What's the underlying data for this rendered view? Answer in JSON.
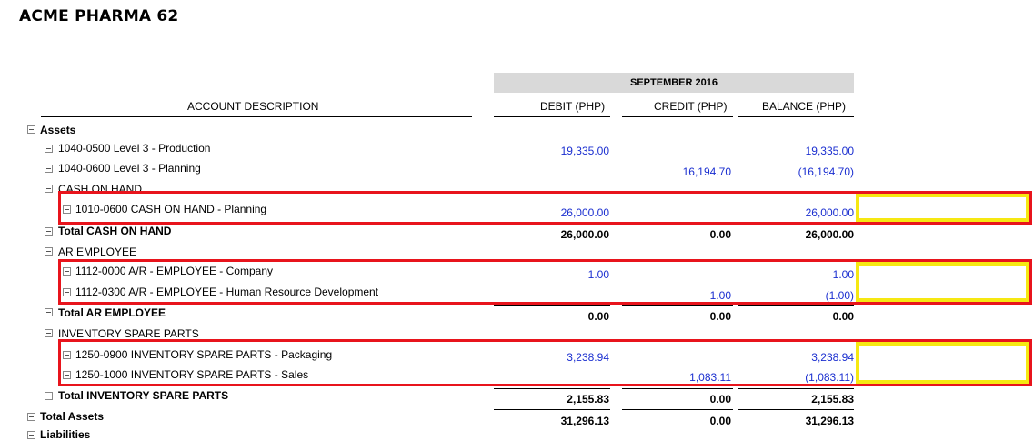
{
  "report": {
    "title": "ACME PHARMA 62",
    "period": "SEPTEMBER 2016",
    "columns": {
      "description": "ACCOUNT DESCRIPTION",
      "debit": "DEBIT (PHP)",
      "credit": "CREDIT (PHP)",
      "balance": "BALANCE (PHP)"
    }
  },
  "rows": {
    "assets": {
      "label": "Assets"
    },
    "r1040_0500": {
      "label": "1040-0500 Level 3 - Production",
      "debit": "19,335.00",
      "balance": "19,335.00"
    },
    "r1040_0600": {
      "label": "1040-0600 Level 3 - Planning",
      "credit": "16,194.70",
      "balance": "(16,194.70)"
    },
    "cash_group": {
      "label": "CASH ON HAND"
    },
    "r1010_0600": {
      "label": "1010-0600 CASH ON HAND - Planning",
      "debit": "26,000.00",
      "balance": "26,000.00"
    },
    "cash_total": {
      "label": "Total CASH ON HAND",
      "debit": "26,000.00",
      "credit": "0.00",
      "balance": "26,000.00"
    },
    "ar_group": {
      "label": "AR EMPLOYEE"
    },
    "r1112_0000": {
      "label": "1112-0000 A/R - EMPLOYEE - Company",
      "debit": "1.00",
      "balance": "1.00"
    },
    "r1112_0300": {
      "label": "1112-0300 A/R - EMPLOYEE - Human Resource Development",
      "credit": "1.00",
      "balance": "(1.00)"
    },
    "ar_total": {
      "label": "Total AR EMPLOYEE",
      "debit": "0.00",
      "credit": "0.00",
      "balance": "0.00"
    },
    "inv_group": {
      "label": "INVENTORY SPARE PARTS"
    },
    "r1250_0900": {
      "label": "1250-0900 INVENTORY SPARE PARTS - Packaging",
      "debit": "3,238.94",
      "balance": "3,238.94"
    },
    "r1250_1000": {
      "label": "1250-1000 INVENTORY SPARE PARTS - Sales",
      "credit": "1,083.11",
      "balance": "(1,083.11)"
    },
    "inv_total": {
      "label": "Total INVENTORY SPARE PARTS",
      "debit": "2,155.83",
      "credit": "0.00",
      "balance": "2,155.83"
    },
    "assets_total": {
      "label": "Total Assets",
      "debit": "31,296.13",
      "credit": "0.00",
      "balance": "31,296.13"
    },
    "next_section_partial": {
      "label": "Liabilities"
    }
  },
  "colors": {
    "value_blue": "#1b2fd0",
    "highlight_red": "#e8141c",
    "highlight_yellow": "#f6e812",
    "header_gray": "#d9d9d9"
  }
}
